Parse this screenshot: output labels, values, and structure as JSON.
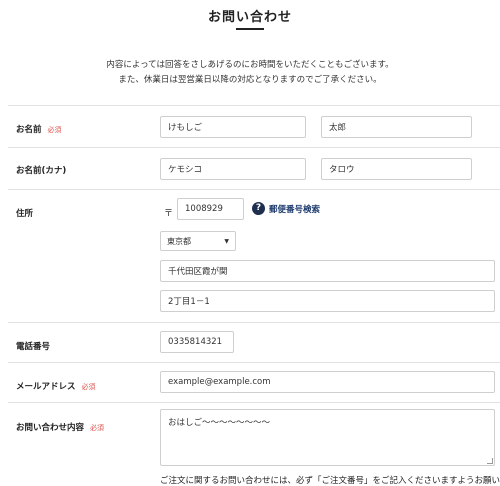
{
  "page": {
    "title": "お問い合わせ",
    "intro_line1": "内容によっては回答をさしあげるのにお時間をいただくこともございます。",
    "intro_line2": "また、休業日は翌営業日以降の対応となりますのでご了承ください。"
  },
  "form": {
    "name": {
      "label": "お名前",
      "required": "必須",
      "last": "けもしご",
      "first": "太郎"
    },
    "kana": {
      "label": "お名前(カナ)",
      "last": "ケモシコ",
      "first": "タロウ"
    },
    "address": {
      "label": "住所",
      "postal_mark": "〒",
      "postal_code": "1008929",
      "help_icon": "?",
      "postal_search_label": "郵便番号検索",
      "prefecture": "東京都",
      "city": "千代田区霞が関",
      "street": "2丁目1－1"
    },
    "phone": {
      "label": "電話番号",
      "value": "0335814321"
    },
    "email": {
      "label": "メールアドレス",
      "required": "必須",
      "placeholder": "example@example.com"
    },
    "inquiry": {
      "label": "お問い合わせ内容",
      "required": "必須",
      "value": "おはしご〜〜〜〜〜〜〜〜",
      "note": "ご注文に関するお問い合わせには、必ず「ご注文番号」をご記入くださいますようお願い"
    }
  },
  "colors": {
    "required": "#d9534f",
    "link": "#1f3c6e",
    "help_icon_bg": "#1f2f4f",
    "divider": "#e2e2e2",
    "input_border": "#cfcfcf"
  },
  "icons": {
    "help": "question-circle-icon",
    "select_caret": "caret-down-icon"
  }
}
